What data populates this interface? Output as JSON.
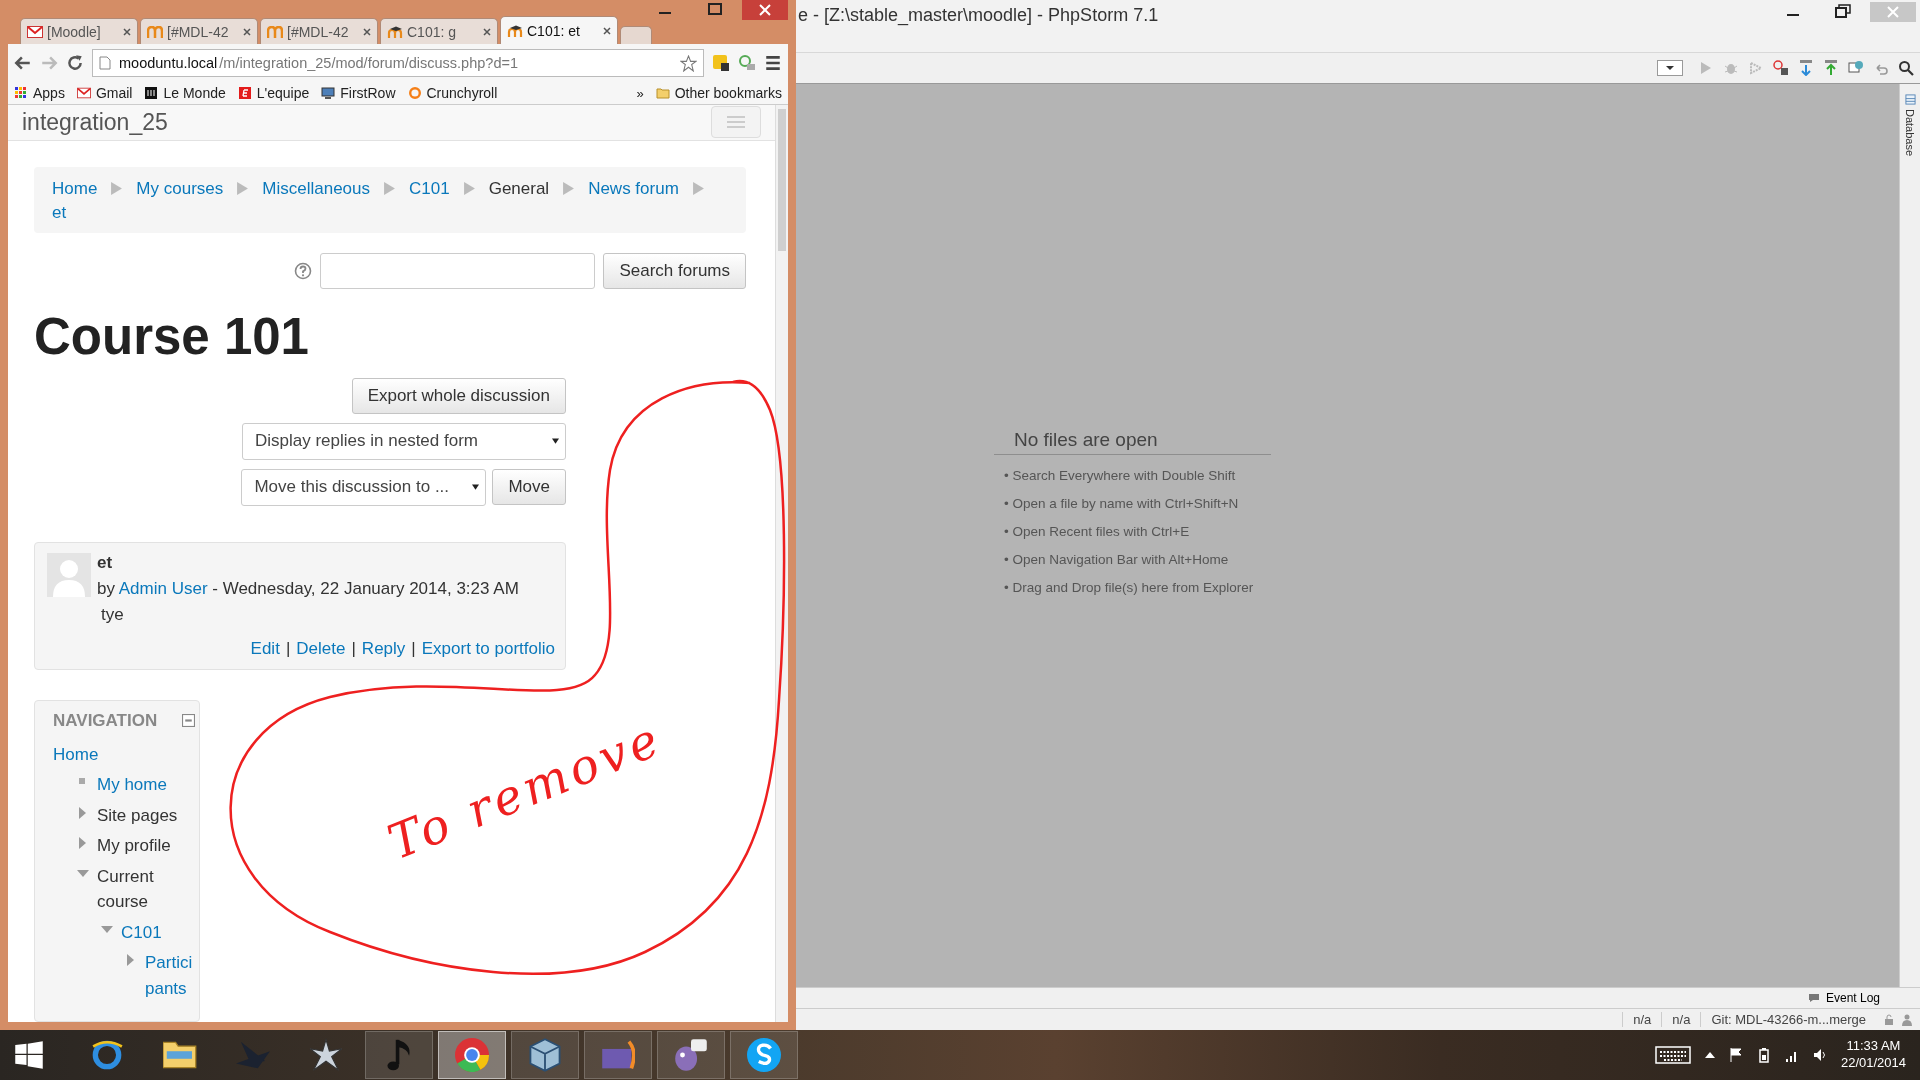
{
  "browser": {
    "tabs": [
      {
        "label": "[Moodle]",
        "selected": false
      },
      {
        "label": "[#MDL-42",
        "selected": false
      },
      {
        "label": "[#MDL-42",
        "selected": false
      },
      {
        "label": "C101: g",
        "selected": false
      },
      {
        "label": "C101: et",
        "selected": true
      }
    ],
    "address": {
      "host": "mooduntu.local",
      "path": "/m/integration_25/mod/forum/discuss.php?d=1"
    },
    "bookmarks": [
      {
        "label": "Apps"
      },
      {
        "label": "Gmail"
      },
      {
        "label": "Le Monde"
      },
      {
        "label": "L'equipe"
      },
      {
        "label": "FirstRow"
      },
      {
        "label": "Crunchyroll"
      }
    ],
    "overflow": "»",
    "other_bookmarks": "Other bookmarks"
  },
  "page": {
    "site_name": "integration_25",
    "breadcrumb": [
      {
        "label": "Home",
        "link": true
      },
      {
        "label": "My courses",
        "link": true
      },
      {
        "label": "Miscellaneous",
        "link": true
      },
      {
        "label": "C101",
        "link": true
      },
      {
        "label": "General",
        "link": false
      },
      {
        "label": "News forum",
        "link": true
      },
      {
        "label": "et",
        "link": true
      }
    ],
    "search_button": "Search forums",
    "heading": "Course 101",
    "export_button": "Export whole discussion",
    "display_select": "Display replies in nested form",
    "move_select": "Move this discussion to ...",
    "move_button": "Move",
    "post": {
      "subject": "et",
      "by": "by",
      "author": "Admin User",
      "date": " - Wednesday, 22 January 2014, 3:23 AM",
      "body": "tye",
      "separator": "|",
      "actions": [
        "Edit",
        "Delete",
        "Reply",
        "Export to portfolio"
      ]
    },
    "navigation": {
      "title": "NAVIGATION",
      "items": [
        {
          "label": "Home",
          "link": true,
          "kind": "root",
          "children": [
            {
              "label": "My home",
              "link": true,
              "kind": "leaf"
            },
            {
              "label": "Site pages",
              "link": false,
              "kind": "branch",
              "expanded": false
            },
            {
              "label": "My profile",
              "link": false,
              "kind": "branch",
              "expanded": false
            },
            {
              "label": "Current course",
              "link": false,
              "kind": "branch",
              "expanded": true,
              "children": [
                {
                  "label": "C101",
                  "link": true,
                  "kind": "branch",
                  "expanded": true,
                  "children": [
                    {
                      "label": "Participants",
                      "link": true,
                      "kind": "branch",
                      "expanded": false
                    }
                  ]
                }
              ]
            }
          ]
        }
      ]
    }
  },
  "annotation": {
    "text": "To remove"
  },
  "ide": {
    "title": "e - [Z:\\stable_master\\moodle] - PhpStorm 7.1",
    "empty_title": "No files are open",
    "hints": [
      "• Search Everywhere with Double Shift",
      "• Open a file by name with Ctrl+Shift+N",
      "• Open Recent files with Ctrl+E",
      "• Open Navigation Bar with Alt+Home",
      "• Drag and Drop file(s) here from Explorer"
    ],
    "side_tab": "Database",
    "event_log": "Event Log",
    "status": [
      "n/a",
      "n/a",
      "Git: MDL-43266-m...merge"
    ]
  },
  "taskbar": {
    "apps": [
      {
        "selected": false
      },
      {
        "selected": false
      },
      {
        "selected": false
      },
      {
        "selected": false
      },
      {
        "selected": false
      },
      {
        "selected": true
      },
      {
        "selected": false
      },
      {
        "selected": false
      },
      {
        "selected": false
      },
      {
        "selected": false
      }
    ],
    "time": "11:33 AM",
    "date": "22/01/2014"
  }
}
